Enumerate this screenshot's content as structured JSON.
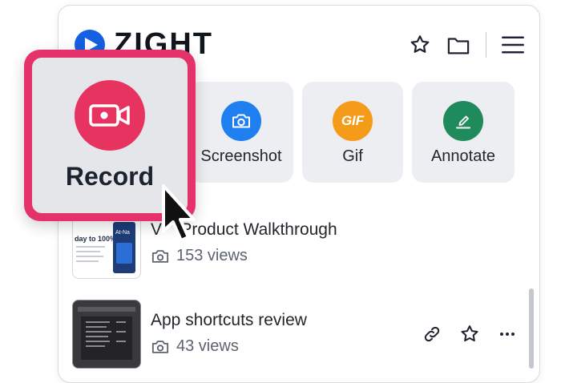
{
  "header": {
    "brand": "ZIGHT",
    "icons": [
      "star-icon",
      "folder-icon",
      "hamburger-menu-icon"
    ]
  },
  "actions": [
    {
      "label": "Record",
      "icon": "video-camera-icon",
      "color": "#e6335f"
    },
    {
      "label": "Screenshot",
      "icon": "camera-icon",
      "color": "#1f7ff0"
    },
    {
      "label": "Gif",
      "icon": "gif-icon",
      "color": "#f59b1a"
    },
    {
      "label": "Annotate",
      "icon": "pen-icon",
      "color": "#1f8a5b"
    }
  ],
  "items": [
    {
      "title": "Video Product Walkthrough",
      "title_visible": "V    Product Walkthrough",
      "views": "153 views",
      "thumb_text": [
        "day to 100%",
        "At-Na"
      ]
    },
    {
      "title": "App shortcuts review",
      "views": "43 views"
    }
  ]
}
